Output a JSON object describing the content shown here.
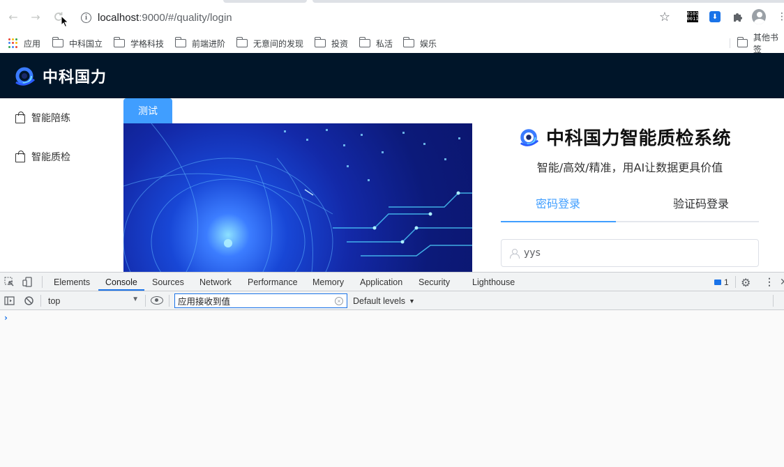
{
  "browser": {
    "url_host": "localhost",
    "url_path": ":9000/#/quality/login",
    "bookmarks": [
      {
        "label": "应用",
        "icon": "apps-grid-icon"
      },
      {
        "label": "中科国立",
        "icon": "folder-icon"
      },
      {
        "label": "学格科技",
        "icon": "folder-icon"
      },
      {
        "label": "前端进阶",
        "icon": "folder-icon"
      },
      {
        "label": "无意间的发现",
        "icon": "folder-icon"
      },
      {
        "label": "投资",
        "icon": "folder-icon"
      },
      {
        "label": "私活",
        "icon": "folder-icon"
      },
      {
        "label": "娱乐",
        "icon": "folder-icon"
      }
    ],
    "other_bookmarks": "其他书签",
    "binary_ext_text": "0101 0011"
  },
  "app": {
    "brand": "中科国力",
    "header_bg": "#001529",
    "accent": "#409eff",
    "sidebar": [
      {
        "label": "智能陪练",
        "icon": "shopping-bag-icon"
      },
      {
        "label": "智能质检",
        "icon": "shopping-bag-icon"
      }
    ],
    "test_button": "测试",
    "system_title": "中科国力智能质检系统",
    "slogan": "智能/高效/精准，用AI让数据更具价值",
    "tabs": {
      "password": "密码登录",
      "code": "验证码登录"
    },
    "username_value": "yys"
  },
  "devtools": {
    "tabs": [
      "Elements",
      "Console",
      "Sources",
      "Network",
      "Performance",
      "Memory",
      "Application",
      "Security",
      "Lighthouse"
    ],
    "active_tab": "Console",
    "issues_count": "1",
    "context": "top",
    "filter_value": "应用接收到值",
    "levels": "Default levels",
    "prompt": "›"
  }
}
